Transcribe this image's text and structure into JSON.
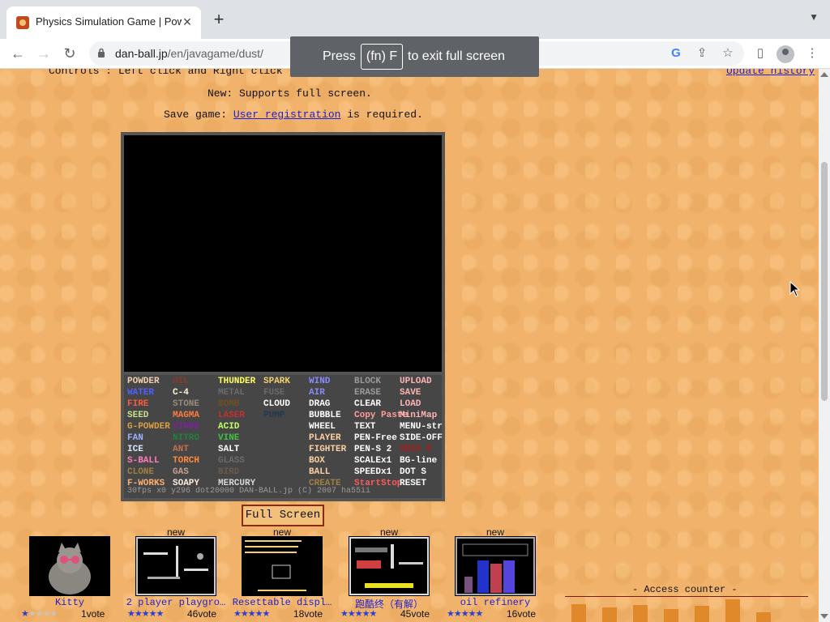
{
  "browser": {
    "tab_title": "Physics Simulation Game | Powder Game",
    "tab_close": "×",
    "new_tab": "+",
    "url_host": "dan-ball.jp",
    "url_path": "/en/javagame/dust/",
    "fullscreen_toast": {
      "before": "Press",
      "key": "(fn) F",
      "after": "to exit full screen"
    }
  },
  "page": {
    "controls": "Controls : Left click and Right click",
    "update_history": "Update history",
    "new_notice": "New: Supports full screen.",
    "save_prefix": "Save game: ",
    "save_link": "User registration",
    "save_suffix": " is required.",
    "fullscreen_button": "Full Screen"
  },
  "game": {
    "elements": [
      {
        "label": "POWDER",
        "color": "#f2cfb0"
      },
      {
        "label": "OIL",
        "color": "#8a3a28"
      },
      {
        "label": "THUNDER",
        "color": "#ffff60"
      },
      {
        "label": "SPARK",
        "color": "#f2d070"
      },
      {
        "label": "WIND",
        "color": "#8888ff"
      },
      {
        "label": "BLOCK",
        "color": "#9a9a9a"
      },
      {
        "label": "UPLOAD",
        "color": "#ffb4b4"
      },
      {
        "label": "WATER",
        "color": "#5060ff"
      },
      {
        "label": "C-4",
        "color": "#fff4d8"
      },
      {
        "label": "METAL",
        "color": "#6a6a6a"
      },
      {
        "label": "FUSE",
        "color": "#6a6a6a"
      },
      {
        "label": "AIR",
        "color": "#8888ff"
      },
      {
        "label": "ERASE",
        "color": "#9a9a9a"
      },
      {
        "label": "SAVE",
        "color": "#ffb4b4"
      },
      {
        "label": "FIRE",
        "color": "#ff5a3a"
      },
      {
        "label": "STONE",
        "color": "#9a8a7a"
      },
      {
        "label": "BOMB",
        "color": "#705020"
      },
      {
        "label": "CLOUD",
        "color": "#ffffff"
      },
      {
        "label": "DRAG",
        "color": "#ffffff"
      },
      {
        "label": "CLEAR",
        "color": "#ffffff"
      },
      {
        "label": "LOAD",
        "color": "#ffb4b4"
      },
      {
        "label": "SEED",
        "color": "#c6e08a"
      },
      {
        "label": "MAGMA",
        "color": "#ff7a40"
      },
      {
        "label": "LASER",
        "color": "#c43030"
      },
      {
        "label": "PUMP",
        "color": "#203850"
      },
      {
        "label": "BUBBLE",
        "color": "#ffffff"
      },
      {
        "label": "Copy Paste",
        "color": "#ff9c9c"
      },
      {
        "label": "MiniMap",
        "color": "#ffb4b4"
      },
      {
        "label": "G-POWDER",
        "color": "#d9a040"
      },
      {
        "label": "VIRUS",
        "color": "#8020a0"
      },
      {
        "label": "ACID",
        "color": "#c0ff60"
      },
      {
        "label": "",
        "color": "#000000"
      },
      {
        "label": "WHEEL",
        "color": "#ffffff"
      },
      {
        "label": "TEXT",
        "color": "#ffffff"
      },
      {
        "label": "MENU-str",
        "color": "#ffffff"
      },
      {
        "label": "FAN",
        "color": "#9ab0ff"
      },
      {
        "label": "NITRO",
        "color": "#208040"
      },
      {
        "label": "VINE",
        "color": "#40c040"
      },
      {
        "label": "",
        "color": "#000000"
      },
      {
        "label": "PLAYER",
        "color": "#ffd0a0"
      },
      {
        "label": "PEN-Free",
        "color": "#ffffff"
      },
      {
        "label": "SIDE-OFF",
        "color": "#ffffff"
      },
      {
        "label": "ICE",
        "color": "#d8e8ff"
      },
      {
        "label": "ANT",
        "color": "#c07050"
      },
      {
        "label": "SALT",
        "color": "#ffffff"
      },
      {
        "label": "",
        "color": "#000000"
      },
      {
        "label": "FIGHTER",
        "color": "#ffd0a0"
      },
      {
        "label": "PEN-S 2",
        "color": "#ffffff"
      },
      {
        "label": "GRID 0",
        "color": "#a02020"
      },
      {
        "label": "S-BALL",
        "color": "#ff7ac0"
      },
      {
        "label": "TORCH",
        "color": "#ff8a40"
      },
      {
        "label": "GLASS",
        "color": "#6a6a6a"
      },
      {
        "label": "",
        "color": "#000000"
      },
      {
        "label": "BOX",
        "color": "#ffd0a0"
      },
      {
        "label": "SCALEx1",
        "color": "#ffffff"
      },
      {
        "label": "BG-line",
        "color": "#ffffff"
      },
      {
        "label": "CLONE",
        "color": "#a08040"
      },
      {
        "label": "GAS",
        "color": "#c8a090"
      },
      {
        "label": "BIRD",
        "color": "#6a5a4a"
      },
      {
        "label": "",
        "color": "#000000"
      },
      {
        "label": "BALL",
        "color": "#ffd0a0"
      },
      {
        "label": "SPEEDx1",
        "color": "#ffffff"
      },
      {
        "label": "DOT S",
        "color": "#ffffff"
      },
      {
        "label": "F-WORKS",
        "color": "#ffb070"
      },
      {
        "label": "SOAPY",
        "color": "#fff0e0"
      },
      {
        "label": "MERCURY",
        "color": "#d8d8d8"
      },
      {
        "label": "",
        "color": "#000000"
      },
      {
        "label": "CREATE",
        "color": "#a08040"
      },
      {
        "label": "StartStop",
        "color": "#ff5a5a"
      },
      {
        "label": "RESET",
        "color": "#ffffff"
      }
    ],
    "status": "30fps  x0    y296  dot20000   DAN-BALL.jp  (C) 2007 ha55ii"
  },
  "thumbnails": [
    {
      "new": "",
      "title": "Kitty",
      "stars": 1,
      "votes": "1vote"
    },
    {
      "new": "new",
      "title": "2 player playgro…",
      "stars": 5,
      "votes": "46vote"
    },
    {
      "new": "new",
      "title": "Resettable displ…",
      "stars": 5,
      "votes": "18vote"
    },
    {
      "new": "new",
      "title": "跑酷终（有解）",
      "stars": 5,
      "votes": "45vote"
    },
    {
      "new": "new",
      "title": "oil refinery",
      "stars": 5,
      "votes": "16vote"
    }
  ],
  "counter": {
    "label": "- Access counter -"
  },
  "colors": {
    "page_bg": "#f1b36b",
    "link": "#2020d0",
    "star": "#2a3fd6"
  }
}
